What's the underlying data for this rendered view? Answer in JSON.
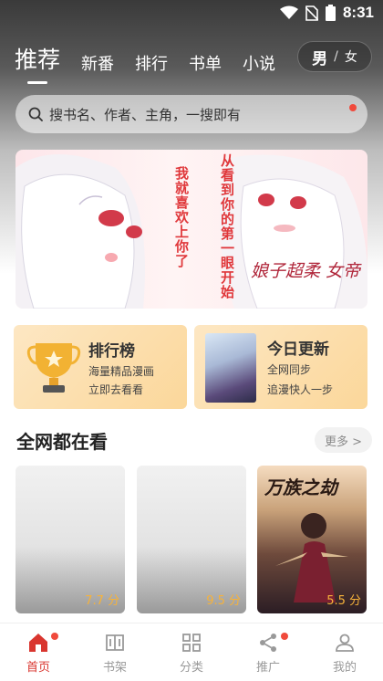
{
  "status_bar": {
    "time": "8:31"
  },
  "header": {
    "tabs": [
      {
        "label": "推荐",
        "active": true
      },
      {
        "label": "新番",
        "active": false
      },
      {
        "label": "排行",
        "active": false
      },
      {
        "label": "书单",
        "active": false
      },
      {
        "label": "小说",
        "active": false
      }
    ],
    "gender": {
      "male": "男",
      "separator": "/",
      "female": "女"
    }
  },
  "search": {
    "placeholder": "搜书名、作者、主角，一搜即有"
  },
  "banner": {
    "caption_col1": "从看到你的第一眼开始",
    "caption_col2": "我就喜欢上你了",
    "logo_text": "娘子超柔 女帝"
  },
  "cards": {
    "ranking": {
      "title": "排行榜",
      "line1": "海量精品漫画",
      "line2": "立即去看看"
    },
    "update": {
      "title": "今日更新",
      "line1": "全网同步",
      "line2": "追漫快人一步"
    }
  },
  "section": {
    "title": "全网都在看",
    "more": "更多 >"
  },
  "books": [
    {
      "score": "7.7 分"
    },
    {
      "score": "9.5 分"
    },
    {
      "score": "5.5 分",
      "cover_title": "万族之劫"
    }
  ],
  "nav": [
    {
      "label": "首页",
      "icon": "home-icon",
      "active": true,
      "badge": true
    },
    {
      "label": "书架",
      "icon": "bookshelf-icon",
      "active": false,
      "badge": false
    },
    {
      "label": "分类",
      "icon": "category-icon",
      "active": false,
      "badge": false
    },
    {
      "label": "推广",
      "icon": "share-icon",
      "active": false,
      "badge": true
    },
    {
      "label": "我的",
      "icon": "profile-icon",
      "active": false,
      "badge": false
    }
  ],
  "colors": {
    "accent": "#d9362f",
    "badge": "#f04a3c",
    "score": "#f6b23a",
    "card_bg": "#fde3b5"
  }
}
